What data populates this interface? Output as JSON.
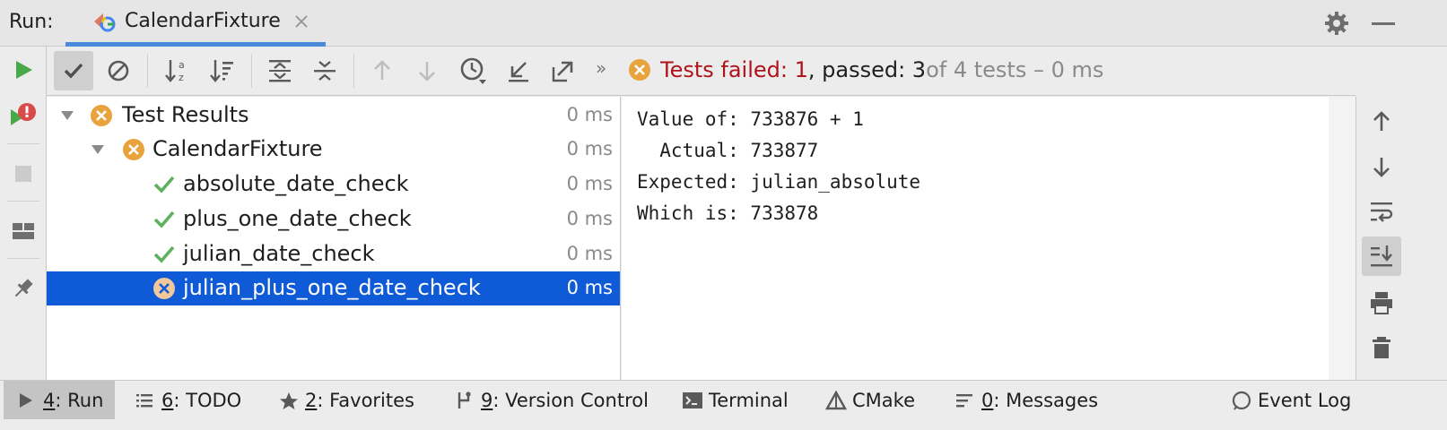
{
  "header": {
    "run_label": "Run:",
    "tab_label": "CalendarFixture"
  },
  "toolbar": {
    "status_failed": "Tests failed: 1",
    "status_passed": ", passed: 3",
    "status_total": " of 4 tests – 0 ms"
  },
  "tree": {
    "rows": [
      {
        "label": "Test Results",
        "duration": "0 ms"
      },
      {
        "label": "CalendarFixture",
        "duration": "0 ms"
      },
      {
        "label": "absolute_date_check",
        "duration": "0 ms"
      },
      {
        "label": "plus_one_date_check",
        "duration": "0 ms"
      },
      {
        "label": "julian_date_check",
        "duration": "0 ms"
      },
      {
        "label": "julian_plus_one_date_check",
        "duration": "0 ms"
      }
    ]
  },
  "console": {
    "output": "Value of: 733876 + 1\n  Actual: 733877\nExpected: julian_absolute\nWhich is: 733878"
  },
  "bottombar": {
    "run": {
      "key": "4",
      "label": ": Run"
    },
    "todo": {
      "key": "6",
      "label": ": TODO"
    },
    "favorites": {
      "key": "2",
      "label": ": Favorites"
    },
    "vcs": {
      "key": "9",
      "label": ": Version Control"
    },
    "terminal": {
      "label": "Terminal"
    },
    "cmake": {
      "label": "CMake"
    },
    "messages": {
      "key": "0",
      "label": ": Messages"
    },
    "eventlog": {
      "label": "Event Log"
    }
  },
  "colors": {
    "accent": "#4a89dc",
    "selection": "#0e5ad7",
    "fail": "#e8a33d",
    "pass": "#5fb15f",
    "fail_text": "#b0121b"
  }
}
